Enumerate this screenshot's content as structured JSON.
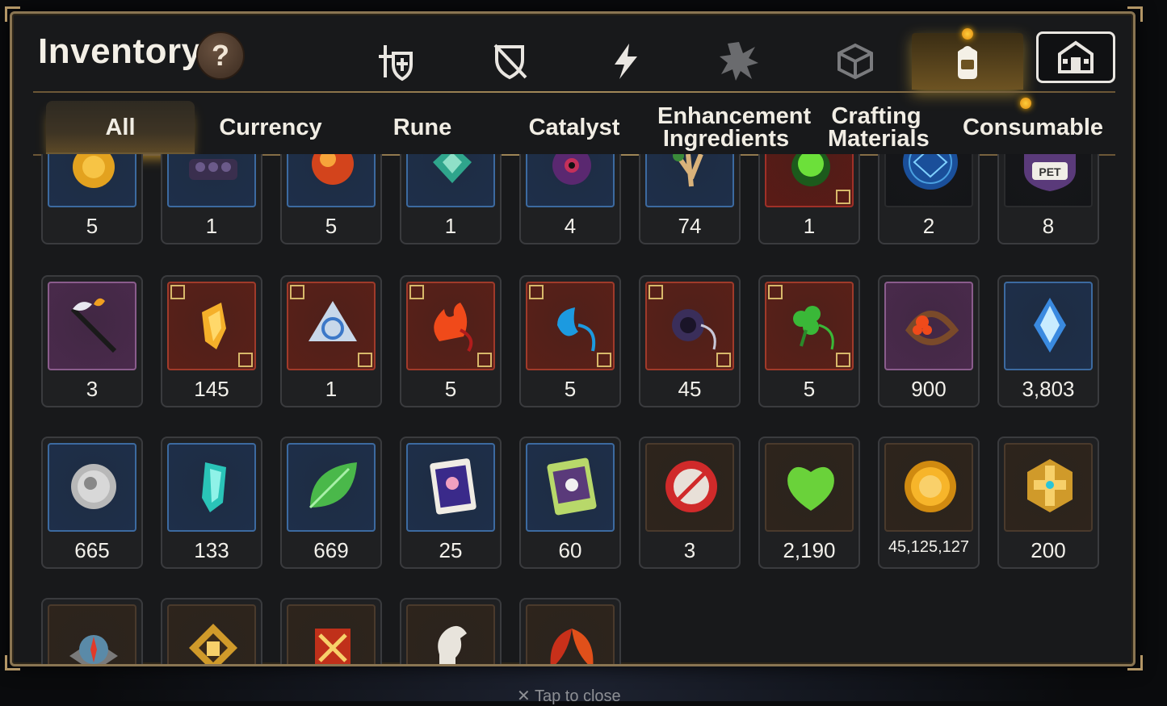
{
  "header": {
    "title": "Inventory",
    "help_label": "?"
  },
  "categories": [
    {
      "icon": "sword-shield-icon",
      "active": false
    },
    {
      "icon": "crossed-shield-icon",
      "active": false
    },
    {
      "icon": "lightning-icon",
      "active": false
    },
    {
      "icon": "spiky-artifact-icon",
      "active": false
    },
    {
      "icon": "cube-icon",
      "active": false
    },
    {
      "icon": "backpack-icon",
      "active": true
    },
    {
      "icon": "fortress-icon",
      "active": false
    }
  ],
  "tabs": [
    {
      "label": "All",
      "active": true
    },
    {
      "label": "Currency"
    },
    {
      "label": "Rune"
    },
    {
      "label": "Catalyst"
    },
    {
      "label": "Enhancement Ingredients"
    },
    {
      "label": "Crafting Materials"
    },
    {
      "label": "Consumable"
    }
  ],
  "items": [
    {
      "icon": "sun-coin-icon",
      "qty": "5",
      "frame": "#3c6aa0",
      "bg": "#1e2f4a"
    },
    {
      "icon": "dark-scales-icon",
      "qty": "1",
      "frame": "#3c6aa0",
      "bg": "#1e2f4a"
    },
    {
      "icon": "magma-orb-icon",
      "qty": "5",
      "frame": "#3c6aa0",
      "bg": "#1e2f4a"
    },
    {
      "icon": "green-gem-icon",
      "qty": "1",
      "frame": "#3c6aa0",
      "bg": "#1e2f4a"
    },
    {
      "icon": "eye-orb-icon",
      "qty": "4",
      "frame": "#3c6aa0",
      "bg": "#1e2f4a"
    },
    {
      "icon": "root-herb-icon",
      "qty": "74",
      "frame": "#3c6aa0",
      "bg": "#1e2f4a"
    },
    {
      "icon": "green-potion-icon",
      "qty": "1",
      "frame": "#a03028",
      "bg": "#5a1b16"
    },
    {
      "icon": "blue-rune-disc-icon",
      "qty": "2",
      "frame": "#2a2b2d",
      "bg": "#141518"
    },
    {
      "icon": "pet-badge-icon",
      "qty": "8",
      "frame": "#2a2b2d",
      "bg": "#141518"
    },
    {
      "icon": "feather-staff-icon",
      "qty": "3",
      "frame": "#8a5c8c",
      "bg": "#4a2a4c"
    },
    {
      "icon": "golden-crystal-icon",
      "qty": "145",
      "frame": "#a03a2a",
      "bg": "#5a2018"
    },
    {
      "icon": "triquetra-crystal-icon",
      "qty": "1",
      "frame": "#a03a2a",
      "bg": "#5a2018"
    },
    {
      "icon": "fire-amulet-icon",
      "qty": "5",
      "frame": "#a03a2a",
      "bg": "#5a2018"
    },
    {
      "icon": "water-amulet-icon",
      "qty": "5",
      "frame": "#a03a2a",
      "bg": "#5a2018"
    },
    {
      "icon": "shadow-amulet-icon",
      "qty": "45",
      "frame": "#a03a2a",
      "bg": "#5a2018"
    },
    {
      "icon": "clover-amulet-icon",
      "qty": "5",
      "frame": "#a03a2a",
      "bg": "#5a2018"
    },
    {
      "icon": "flower-ring-icon",
      "qty": "900",
      "frame": "#8a5c8c",
      "bg": "#4a2a4c"
    },
    {
      "icon": "blue-crystal-icon",
      "qty": "3,803",
      "frame": "#3c6aa0",
      "bg": "#1e2f4a"
    },
    {
      "icon": "silver-coin-icon",
      "qty": "665",
      "frame": "#3c6aa0",
      "bg": "#1e2f4a"
    },
    {
      "icon": "teal-shard-icon",
      "qty": "133",
      "frame": "#3c6aa0",
      "bg": "#1e2f4a"
    },
    {
      "icon": "green-leaf-icon",
      "qty": "669",
      "frame": "#3c6aa0",
      "bg": "#1e2f4a"
    },
    {
      "icon": "purple-scroll-icon",
      "qty": "25",
      "frame": "#3c6aa0",
      "bg": "#1e2f4a"
    },
    {
      "icon": "green-scroll-icon",
      "qty": "60",
      "frame": "#3c6aa0",
      "bg": "#1e2f4a"
    },
    {
      "icon": "red-seal-icon",
      "qty": "3",
      "frame": "#4a3a2c",
      "bg": "#2e241c"
    },
    {
      "icon": "green-heart-icon",
      "qty": "2,190",
      "frame": "#4a3a2c",
      "bg": "#2e241c"
    },
    {
      "icon": "gold-coin-icon",
      "qty": "45,125,127",
      "frame": "#4a3a2c",
      "bg": "#2e241c"
    },
    {
      "icon": "gold-hex-emblem-icon",
      "qty": "200",
      "frame": "#4a3a2c",
      "bg": "#2e241c"
    },
    {
      "icon": "compass-stone-icon",
      "qty": "",
      "frame": "#4a3a2c",
      "bg": "#2e241c"
    },
    {
      "icon": "fist-emblem-icon",
      "qty": "",
      "frame": "#4a3a2c",
      "bg": "#2e241c"
    },
    {
      "icon": "battle-banner-icon",
      "qty": "",
      "frame": "#4a3a2c",
      "bg": "#2e241c"
    },
    {
      "icon": "knight-piece-icon",
      "qty": "",
      "frame": "#4a3a2c",
      "bg": "#2e241c"
    },
    {
      "icon": "red-leaves-icon",
      "qty": "",
      "frame": "#4a3a2c",
      "bg": "#2e241c"
    }
  ],
  "footer": {
    "close_hint": "Tap to close"
  }
}
